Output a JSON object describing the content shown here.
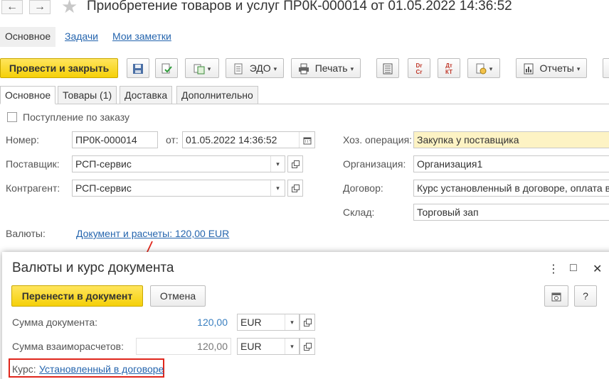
{
  "window": {
    "title": "Приобретение товаров и услуг ПР0К-000014 от 01.05.2022 14:36:52",
    "back_glyph": "←",
    "forward_glyph": "→",
    "favorite_glyph": "★"
  },
  "top_nav": {
    "items": [
      "Основное",
      "Задачи",
      "Мои заметки"
    ]
  },
  "toolbar": {
    "post_and_close": "Провести и закрыть",
    "edo": "ЭДО",
    "print": "Печать",
    "reports": "Отчеты",
    "dr_cr_top": "Dr",
    "dr_cr_bottom": "Cr",
    "dt_kt_top": "Дт",
    "dt_kt_bottom": "КТ",
    "dropdown_glyph": "▾"
  },
  "tabs": [
    "Основное",
    "Товары (1)",
    "Доставка",
    "Дополнительно"
  ],
  "form": {
    "by_order_label": "Поступление по заказу",
    "number_label": "Номер:",
    "number_value": "ПР0К-000014",
    "date_label": "от:",
    "date_value": "01.05.2022 14:36:52",
    "supplier_label": "Поставщик:",
    "supplier_value": "РСП-сервис",
    "counterparty_label": "Контрагент:",
    "counterparty_value": "РСП-сервис",
    "operation_label": "Хоз. операция:",
    "operation_value": "Закупка у поставщика",
    "organization_label": "Организация:",
    "organization_value": "Организация1",
    "contract_label": "Договор:",
    "contract_value": "Курс установленный в договоре, оплата в р",
    "warehouse_label": "Склад:",
    "warehouse_value": "Торговый зап",
    "currencies_label": "Валюты:",
    "currencies_link": "Документ и расчеты: 120,00 EUR"
  },
  "popup": {
    "title": "Валюты и курс документа",
    "more_glyph": "⋮",
    "maximize_glyph": "□",
    "close_glyph": "✕",
    "transfer_button": "Перенести в документ",
    "cancel_button": "Отмена",
    "help_button": "?",
    "doc_sum_label": "Сумма документа:",
    "doc_sum_value": "120,00",
    "doc_sum_currency": "EUR",
    "settle_sum_label": "Сумма взаиморасчетов:",
    "settle_sum_value": "120,00",
    "settle_sum_currency": "EUR",
    "rate_label": "Курс:",
    "rate_link": "Установленный в договоре"
  },
  "colors": {
    "accent_yellow": "#f5d008",
    "link_blue": "#2565ae",
    "highlight_red": "#e0261b",
    "operation_field": "#fdf3c4"
  }
}
